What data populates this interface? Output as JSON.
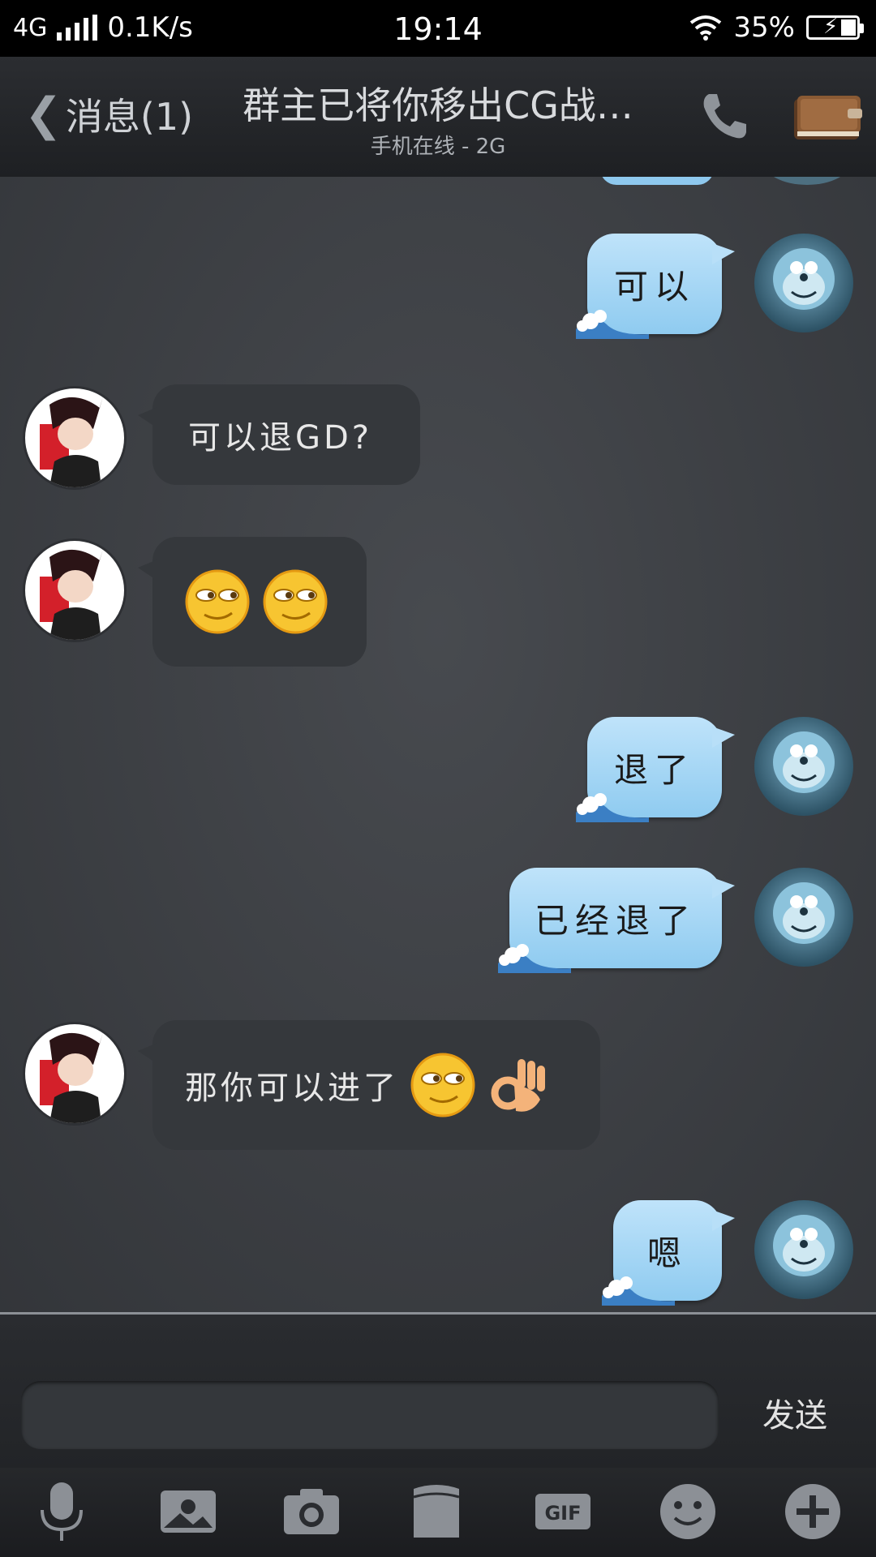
{
  "status": {
    "network": "4G",
    "speed": "0.1K/s",
    "time": "19:14",
    "battery": "35%"
  },
  "header": {
    "back_label": "消息(1)",
    "title": "群主已将你移出CG战…",
    "subtitle": "手机在线 - 2G"
  },
  "messages": [
    {
      "side": "out",
      "text": "可以"
    },
    {
      "side": "in",
      "text": "可以退GD?"
    },
    {
      "side": "in",
      "emojis": [
        "smirk-emoji",
        "smirk-emoji"
      ]
    },
    {
      "side": "out",
      "text": "退了"
    },
    {
      "side": "out",
      "text": "已经退了"
    },
    {
      "side": "in",
      "text": "那你可以进了",
      "emojis": [
        "smirk-emoji",
        "ok-hand-emoji"
      ]
    },
    {
      "side": "out",
      "text": "嗯"
    }
  ],
  "input": {
    "value": "",
    "send_label": "发送"
  },
  "toolbar": [
    "microphone-icon",
    "photo-album-icon",
    "camera-icon",
    "folder-icon",
    "gif-icon",
    "emoji-icon",
    "plus-icon"
  ]
}
